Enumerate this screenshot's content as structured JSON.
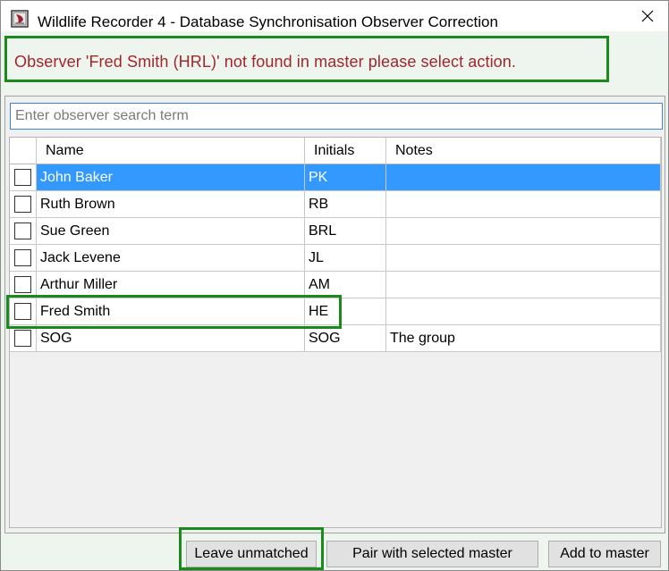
{
  "window": {
    "title": "Wildlife Recorder 4 - Database Synchronisation Observer Correction",
    "icon": "wildlife-recorder-app-icon"
  },
  "message": "Observer 'Fred Smith (HRL)' not found in master please select action.",
  "search": {
    "value": "",
    "placeholder": "Enter observer search term"
  },
  "grid": {
    "columns": [
      "",
      "Name",
      "Initials",
      "Notes"
    ],
    "rows": [
      {
        "name": "John Baker",
        "initials": "PK",
        "notes": "",
        "checked": false,
        "selected": true
      },
      {
        "name": "Ruth Brown",
        "initials": "RB",
        "notes": "",
        "checked": false,
        "selected": false
      },
      {
        "name": "Sue Green",
        "initials": "BRL",
        "notes": "",
        "checked": false,
        "selected": false
      },
      {
        "name": "Jack Levene",
        "initials": "JL",
        "notes": "",
        "checked": false,
        "selected": false
      },
      {
        "name": "Arthur Miller",
        "initials": "AM",
        "notes": "",
        "checked": false,
        "selected": false
      },
      {
        "name": "Fred Smith",
        "initials": "HE",
        "notes": "",
        "checked": false,
        "selected": false
      },
      {
        "name": "SOG",
        "initials": "SOG",
        "notes": "The group",
        "checked": false,
        "selected": false
      }
    ]
  },
  "buttons": {
    "leave_unmatched": "Leave unmatched",
    "pair_with_selected": "Pair with selected master",
    "add_to_master": "Add to master"
  },
  "colors": {
    "highlight": "#1a8a1a",
    "message_text": "#a3262a",
    "selection": "#3399ff",
    "background": "#eef5ef"
  }
}
